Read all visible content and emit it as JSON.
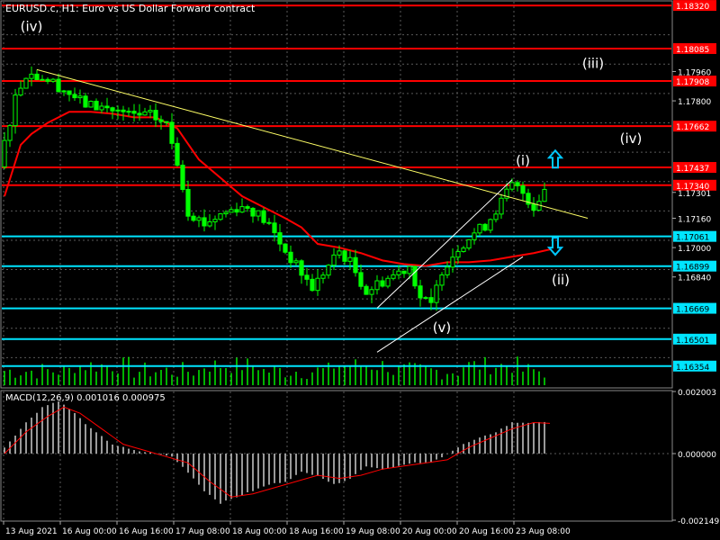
{
  "header": {
    "symbol_title": "EURUSD.c, H1:  Euro vs US Dollar Forward contract",
    "macd_label": "MACD(12,26,9) 0.001016 0.000975"
  },
  "colors": {
    "background": "#000000",
    "grid": "#5a5a5a",
    "candle": "#00ff00",
    "ma": "#ff0000",
    "support_line": "#00e5ff",
    "resistance_line": "#ff0000",
    "trendline": "#ffff66",
    "channel": "#ffffff",
    "arrow": "#00c8ff",
    "volume": "#00ff00",
    "macd_hist": "#c0c0c0",
    "macd_signal": "#ff0000",
    "text": "#ffffff"
  },
  "chart_data": {
    "type": "candlestick",
    "symbol": "EURUSD.c",
    "timeframe": "H1",
    "ylim": [
      1.1624,
      1.1834
    ],
    "x_ticks": [
      "13 Aug 2021",
      "16 Aug 00:00",
      "16 Aug 16:00",
      "17 Aug 08:00",
      "18 Aug 00:00",
      "18 Aug 16:00",
      "19 Aug 08:00",
      "20 Aug 00:00",
      "20 Aug 16:00",
      "23 Aug 08:00"
    ],
    "y_ticks": [
      "1.17960",
      "1.17800",
      "1.17301",
      "1.17160",
      "1.17000",
      "1.16840"
    ],
    "close_path": [
      [
        0,
        1.1744
      ],
      [
        3,
        1.1782
      ],
      [
        5,
        1.1795
      ],
      [
        8,
        1.1793
      ],
      [
        10,
        1.179
      ],
      [
        13,
        1.1784
      ],
      [
        16,
        1.1778
      ],
      [
        20,
        1.1776
      ],
      [
        24,
        1.1772
      ],
      [
        28,
        1.1772
      ],
      [
        31,
        1.1767
      ],
      [
        33,
        1.1747
      ],
      [
        35,
        1.172
      ],
      [
        38,
        1.1713
      ],
      [
        41,
        1.1718
      ],
      [
        44,
        1.1722
      ],
      [
        46,
        1.1722
      ],
      [
        48,
        1.1718
      ],
      [
        50,
        1.1712
      ],
      [
        53,
        1.1698
      ],
      [
        55,
        1.169
      ],
      [
        58,
        1.1678
      ],
      [
        60,
        1.1686
      ],
      [
        63,
        1.1698
      ],
      [
        65,
        1.1692
      ],
      [
        68,
        1.1676
      ],
      [
        70,
        1.168
      ],
      [
        73,
        1.1685
      ],
      [
        76,
        1.169
      ],
      [
        78,
        1.1673
      ],
      [
        80,
        1.1668
      ],
      [
        82,
        1.1688
      ],
      [
        85,
        1.17
      ],
      [
        88,
        1.1708
      ],
      [
        90,
        1.1712
      ],
      [
        93,
        1.1725
      ],
      [
        95,
        1.1734
      ],
      [
        97,
        1.173
      ],
      [
        99,
        1.1722
      ],
      [
        101,
        1.1732
      ]
    ],
    "ma_path": [
      [
        0,
        1.1728
      ],
      [
        3,
        1.1756
      ],
      [
        5,
        1.1762
      ],
      [
        8,
        1.1768
      ],
      [
        12,
        1.1774
      ],
      [
        16,
        1.1774
      ],
      [
        20,
        1.1773
      ],
      [
        24,
        1.1771
      ],
      [
        28,
        1.1771
      ],
      [
        32,
        1.1765
      ],
      [
        36,
        1.1748
      ],
      [
        40,
        1.1738
      ],
      [
        44,
        1.1728
      ],
      [
        48,
        1.1722
      ],
      [
        52,
        1.1716
      ],
      [
        55,
        1.1711
      ],
      [
        58,
        1.1702
      ],
      [
        62,
        1.17
      ],
      [
        66,
        1.1697
      ],
      [
        70,
        1.1693
      ],
      [
        74,
        1.1691
      ],
      [
        78,
        1.169
      ],
      [
        82,
        1.1692
      ],
      [
        86,
        1.1692
      ],
      [
        90,
        1.1693
      ],
      [
        94,
        1.1695
      ],
      [
        98,
        1.1697
      ],
      [
        101,
        1.1699
      ]
    ],
    "horizontal_levels": [
      {
        "label": "1.18320",
        "value": 1.1832,
        "kind": "resistance"
      },
      {
        "label": "1.18085",
        "value": 1.18085,
        "kind": "resistance"
      },
      {
        "label": "1.17908",
        "value": 1.17908,
        "kind": "resistance"
      },
      {
        "label": "1.17662",
        "value": 1.17662,
        "kind": "resistance"
      },
      {
        "label": "1.17437",
        "value": 1.17437,
        "kind": "resistance"
      },
      {
        "label": "1.17340",
        "value": 1.1734,
        "kind": "resistance"
      },
      {
        "label": "1.17061",
        "value": 1.17061,
        "kind": "support"
      },
      {
        "label": "1.16899",
        "value": 1.16899,
        "kind": "support"
      },
      {
        "label": "1.16669",
        "value": 1.16669,
        "kind": "support"
      },
      {
        "label": "1.16501",
        "value": 1.16501,
        "kind": "support"
      },
      {
        "label": "1.16354",
        "value": 1.16354,
        "kind": "support"
      }
    ],
    "wave_labels": [
      {
        "text": "(iv)",
        "bar": 5,
        "value": 1.1818
      },
      {
        "text": "(iii)",
        "bar": 109,
        "value": 1.1798
      },
      {
        "text": "(iv)",
        "bar": 116,
        "value": 1.1757
      },
      {
        "text": "(i)",
        "bar": 96,
        "value": 1.1745
      },
      {
        "text": "(ii)",
        "bar": 103,
        "value": 1.168
      },
      {
        "text": "(v)",
        "bar": 81,
        "value": 1.1654
      }
    ],
    "trendline": {
      "from": [
        6,
        1.1797
      ],
      "to": [
        108,
        1.1716
      ]
    },
    "channel": {
      "upper": {
        "from": [
          69,
          1.1667
        ],
        "to": [
          94,
          1.1737
        ]
      },
      "lower": {
        "from": [
          69,
          1.1643
        ],
        "to": [
          96,
          1.1695
        ]
      }
    },
    "arrows": [
      {
        "direction": "up",
        "bar": 102,
        "value": 1.1748
      },
      {
        "direction": "down",
        "bar": 102,
        "value": 1.1701
      }
    ],
    "macd": {
      "ylim": [
        -0.002149,
        0.002003
      ],
      "y_ticks": [
        "0.002003",
        "0.000000",
        "-0.002149"
      ],
      "hist_path": [
        [
          0,
          0.0002
        ],
        [
          4,
          0.001
        ],
        [
          7,
          0.0015
        ],
        [
          10,
          0.0017
        ],
        [
          13,
          0.0013
        ],
        [
          16,
          0.0008
        ],
        [
          20,
          0.0003
        ],
        [
          24,
          0.0001
        ],
        [
          28,
          0.0
        ],
        [
          31,
          -0.0001
        ],
        [
          34,
          -0.0006
        ],
        [
          37,
          -0.0012
        ],
        [
          40,
          -0.0016
        ],
        [
          43,
          -0.0014
        ],
        [
          46,
          -0.0012
        ],
        [
          49,
          -0.001
        ],
        [
          52,
          -0.0009
        ],
        [
          55,
          -0.0006
        ],
        [
          58,
          -0.0007
        ],
        [
          61,
          -0.001
        ],
        [
          64,
          -0.0008
        ],
        [
          67,
          -0.0004
        ],
        [
          70,
          -0.0005
        ],
        [
          73,
          -0.0004
        ],
        [
          76,
          -0.0003
        ],
        [
          79,
          -0.0003
        ],
        [
          82,
          0.0
        ],
        [
          85,
          0.0003
        ],
        [
          88,
          0.0005
        ],
        [
          91,
          0.0007
        ],
        [
          94,
          0.001
        ],
        [
          97,
          0.001
        ],
        [
          101,
          0.001
        ]
      ],
      "signal_path": [
        [
          0,
          0.0
        ],
        [
          4,
          0.0007
        ],
        [
          8,
          0.0012
        ],
        [
          11,
          0.0015
        ],
        [
          14,
          0.0013
        ],
        [
          18,
          0.0008
        ],
        [
          22,
          0.0003
        ],
        [
          26,
          0.0001
        ],
        [
          30,
          -0.0001
        ],
        [
          34,
          -0.0003
        ],
        [
          38,
          -0.0009
        ],
        [
          42,
          -0.0014
        ],
        [
          46,
          -0.0013
        ],
        [
          50,
          -0.0011
        ],
        [
          54,
          -0.0009
        ],
        [
          58,
          -0.0007
        ],
        [
          62,
          -0.0008
        ],
        [
          66,
          -0.0007
        ],
        [
          70,
          -0.0005
        ],
        [
          74,
          -0.0004
        ],
        [
          78,
          -0.0003
        ],
        [
          82,
          -0.0002
        ],
        [
          86,
          0.0002
        ],
        [
          90,
          0.0005
        ],
        [
          94,
          0.0008
        ],
        [
          98,
          0.001
        ],
        [
          101,
          0.000975
        ]
      ]
    }
  }
}
